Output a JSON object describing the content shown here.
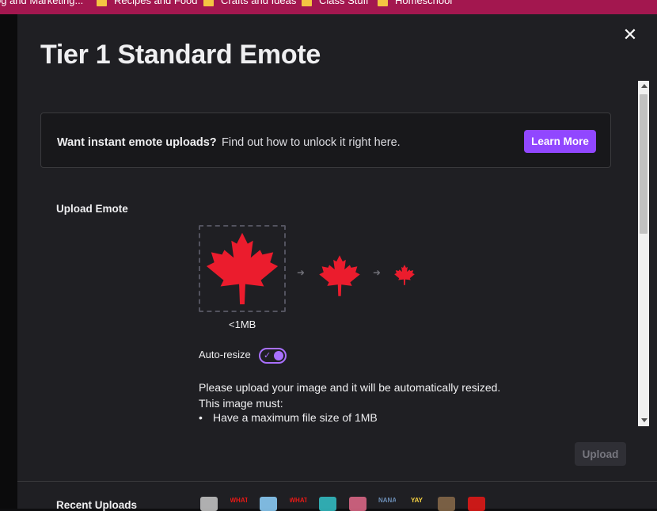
{
  "bookmarks": [
    {
      "label": "og and Marketing..."
    },
    {
      "label": "Recipes and Food"
    },
    {
      "label": "Crafts and Ideas"
    },
    {
      "label": "Class Stuff"
    },
    {
      "label": "Homeschool"
    }
  ],
  "modal": {
    "title": "Tier 1 Standard Emote",
    "close_icon": "close-icon"
  },
  "banner": {
    "strong_text": "Want instant emote uploads?",
    "text": "Find out how to unlock it right here.",
    "button_label": "Learn More"
  },
  "upload_section": {
    "label": "Upload Emote",
    "size_label": "<1MB",
    "auto_resize_label": "Auto-resize",
    "auto_resize_on": true,
    "info_line1": "Please upload your image and it will be automatically resized.",
    "info_line2": "This image must:",
    "requirements": [
      "Have a maximum file size of 1MB"
    ],
    "preview_icon": "maple-leaf-icon"
  },
  "footer": {
    "upload_button": "Upload",
    "recent_uploads_label": "Recent Uploads",
    "recent_thumbs": [
      {
        "label": "",
        "color": "#c9c9c9"
      },
      {
        "label": "WHAT",
        "color": "#e91916"
      },
      {
        "label": "",
        "color": "#8fd3ff"
      },
      {
        "label": "WHAT",
        "color": "#e91916"
      },
      {
        "label": "",
        "color": "#34c3c9"
      },
      {
        "label": "",
        "color": "#e36a8a"
      },
      {
        "label": "NANA",
        "color": "#6b8db5"
      },
      {
        "label": "YAY",
        "color": "#f5d142"
      },
      {
        "label": "",
        "color": "#8a6b4a"
      },
      {
        "label": "",
        "color": "#e91916"
      }
    ]
  },
  "colors": {
    "accent": "#9147ff",
    "leaf": "#eb1c2d",
    "bookmark_bar": "#a3174f"
  }
}
